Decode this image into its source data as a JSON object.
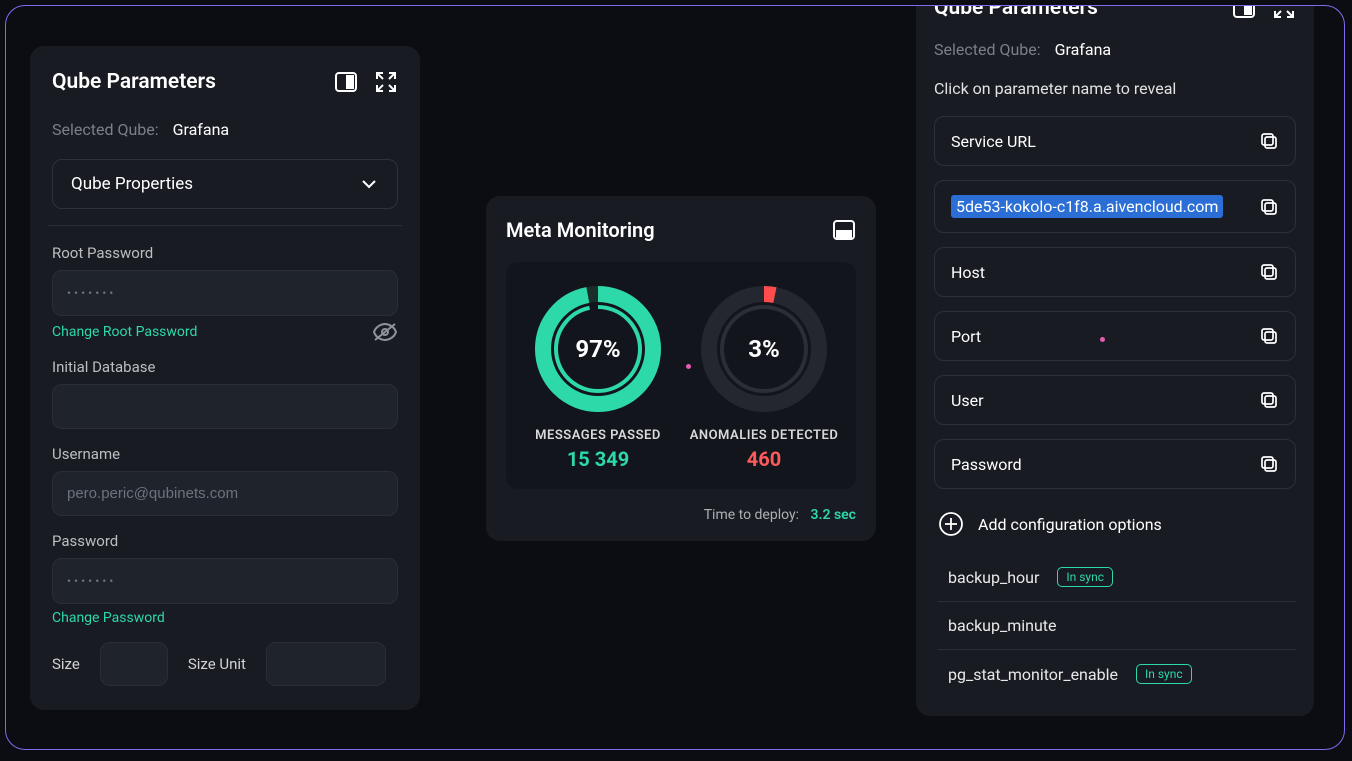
{
  "left": {
    "title": "Qube Parameters",
    "selected_label": "Selected Qube:",
    "selected_value": "Grafana",
    "dropdown_label": "Qube Properties",
    "root_password_label": "Root Password",
    "root_password_value": "•••••••",
    "change_root_password": "Change Root Password",
    "initial_db_label": "Initial Database",
    "username_label": "Username",
    "username_placeholder": "pero.peric@qubinets.com",
    "password_label": "Password",
    "password_value": "•••••••",
    "change_password": "Change Password",
    "size_label": "Size",
    "size_unit_label": "Size Unit"
  },
  "mid": {
    "title": "Meta Monitoring",
    "gauges": {
      "passed": {
        "percent": "97%",
        "label": "MESSAGES PASSED",
        "value": "15 349",
        "pct_num": 97
      },
      "anom": {
        "percent": "3%",
        "label": "ANOMALIES DETECTED",
        "value": "460",
        "pct_num": 3
      }
    },
    "deploy_label": "Time to deploy:",
    "deploy_value": "3.2 sec"
  },
  "right": {
    "title": "Qube Parameters",
    "selected_label": "Selected Qube:",
    "selected_value": "Grafana",
    "hint": "Click on parameter name to reveal",
    "params": {
      "service_url_label": "Service URL",
      "service_url_value": "5de53-kokolo-c1f8.a.aivencloud.com",
      "host_label": "Host",
      "port_label": "Port",
      "user_label": "User",
      "password_label": "Password"
    },
    "add_label": "Add configuration options",
    "configs": {
      "c0": {
        "name": "backup_hour",
        "status": "In sync"
      },
      "c1": {
        "name": "backup_minute",
        "status": ""
      },
      "c2": {
        "name": "pg_stat_monitor_enable",
        "status": "In sync"
      }
    }
  }
}
